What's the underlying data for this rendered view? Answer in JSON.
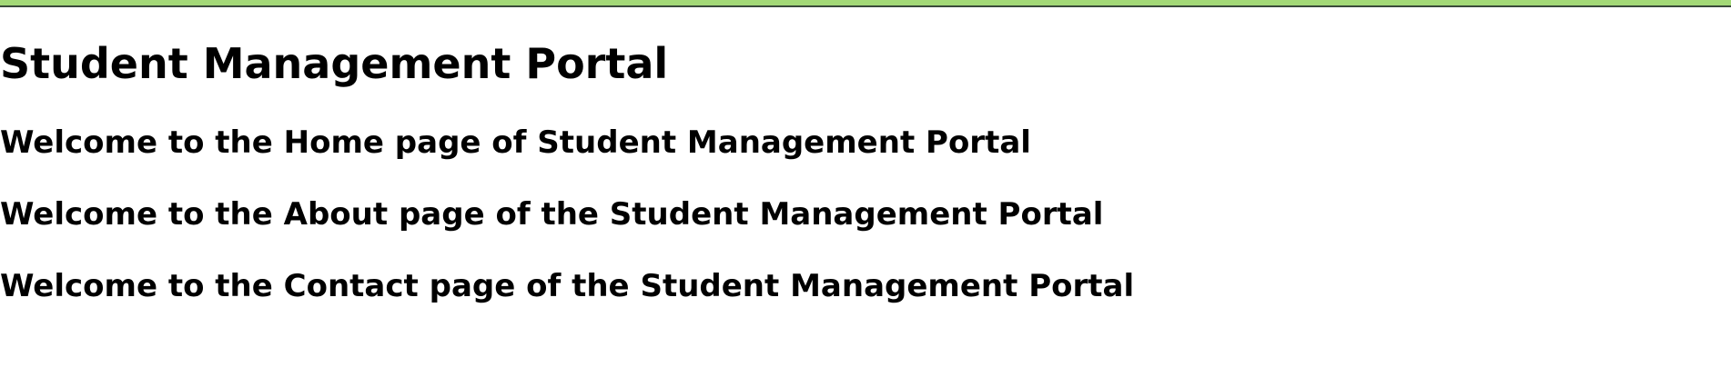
{
  "header": {
    "title": "Student Management Portal",
    "bar_color": "#a3d977"
  },
  "sections": {
    "home": "Welcome to the Home page of Student Management Portal",
    "about": "Welcome to the About page of the Student Management Portal",
    "contact": "Welcome to the Contact page of the Student Management Portal"
  }
}
